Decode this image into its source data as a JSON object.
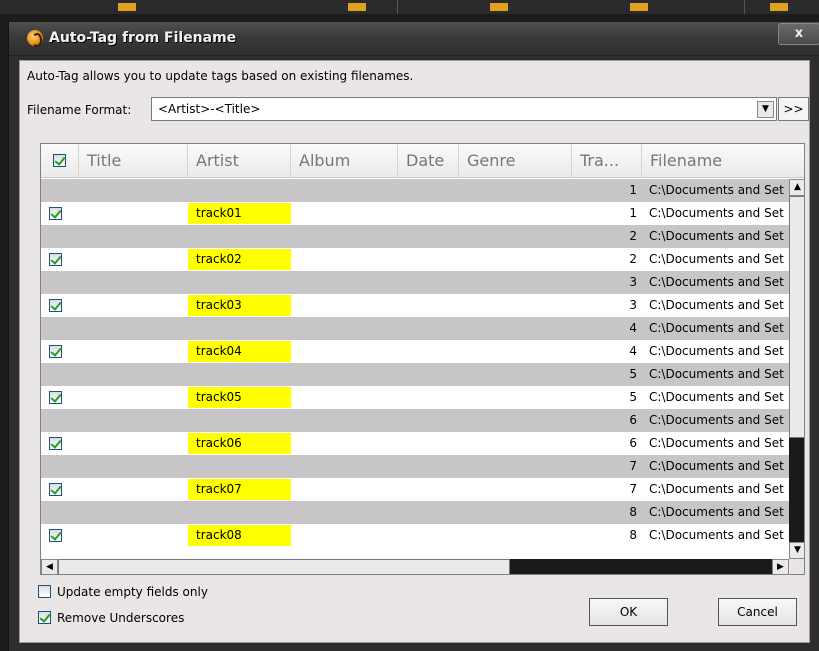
{
  "window": {
    "title": "Auto-Tag from Filename",
    "close_label": "x"
  },
  "description": "Auto-Tag allows you to update tags based on existing filenames.",
  "filename_format": {
    "label": "Filename Format:",
    "value": "<Artist>-<Title>",
    "more_button": ">>"
  },
  "table": {
    "header_checked": true,
    "columns": [
      "Title",
      "Artist",
      "Album",
      "Date",
      "Genre",
      "Tra...",
      "Filename"
    ],
    "rows": [
      {
        "checked": null,
        "artist": "",
        "track": "1",
        "filename": "C:\\Documents and Set"
      },
      {
        "checked": true,
        "artist": "track01",
        "track": "1",
        "filename": "C:\\Documents and Set"
      },
      {
        "checked": null,
        "artist": "",
        "track": "2",
        "filename": "C:\\Documents and Set"
      },
      {
        "checked": true,
        "artist": "track02",
        "track": "2",
        "filename": "C:\\Documents and Set"
      },
      {
        "checked": null,
        "artist": "",
        "track": "3",
        "filename": "C:\\Documents and Set"
      },
      {
        "checked": true,
        "artist": "track03",
        "track": "3",
        "filename": "C:\\Documents and Set"
      },
      {
        "checked": null,
        "artist": "",
        "track": "4",
        "filename": "C:\\Documents and Set"
      },
      {
        "checked": true,
        "artist": "track04",
        "track": "4",
        "filename": "C:\\Documents and Set"
      },
      {
        "checked": null,
        "artist": "",
        "track": "5",
        "filename": "C:\\Documents and Set"
      },
      {
        "checked": true,
        "artist": "track05",
        "track": "5",
        "filename": "C:\\Documents and Set"
      },
      {
        "checked": null,
        "artist": "",
        "track": "6",
        "filename": "C:\\Documents and Set"
      },
      {
        "checked": true,
        "artist": "track06",
        "track": "6",
        "filename": "C:\\Documents and Set"
      },
      {
        "checked": null,
        "artist": "",
        "track": "7",
        "filename": "C:\\Documents and Set"
      },
      {
        "checked": true,
        "artist": "track07",
        "track": "7",
        "filename": "C:\\Documents and Set"
      },
      {
        "checked": null,
        "artist": "",
        "track": "8",
        "filename": "C:\\Documents and Set"
      },
      {
        "checked": true,
        "artist": "track08",
        "track": "8",
        "filename": "C:\\Documents and Set"
      }
    ]
  },
  "options": {
    "update_empty": {
      "label": "Update empty fields only",
      "checked": false
    },
    "remove_underscores": {
      "label": "Remove Underscores",
      "checked": true
    }
  },
  "buttons": {
    "ok": "OK",
    "cancel": "Cancel"
  },
  "colors": {
    "highlight": "#ffff00",
    "alt_row": "#c8c5c8",
    "dialog_bg": "#ebe6e6"
  }
}
